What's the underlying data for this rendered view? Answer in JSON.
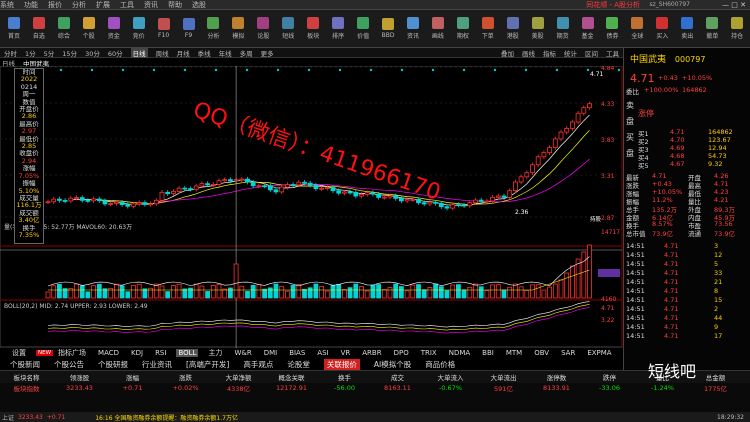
{
  "titlebar": {
    "menu": [
      "系统",
      "功能",
      "报价",
      "分析",
      "扩展",
      "工具",
      "资讯",
      "帮助",
      "选股"
    ],
    "brand": "同花顺 - A股分析",
    "right": "sz_SH600797"
  },
  "toolbar": {
    "buttons": [
      {
        "label": "首页",
        "color": "#4a7fd0"
      },
      {
        "label": "自选",
        "color": "#d04040"
      },
      {
        "label": "综合",
        "color": "#40a060"
      },
      {
        "label": "个股",
        "color": "#d0a030"
      },
      {
        "label": "资金",
        "color": "#a050c0"
      },
      {
        "label": "竞价",
        "color": "#40a0c0"
      },
      {
        "label": "F10",
        "color": "#c05050"
      },
      {
        "label": "F9",
        "color": "#5070c0"
      },
      {
        "label": "分析",
        "color": "#50a050"
      },
      {
        "label": "模拟",
        "color": "#c08030"
      },
      {
        "label": "论股",
        "color": "#a04080"
      },
      {
        "label": "短线",
        "color": "#4080a0"
      },
      {
        "label": "板块",
        "color": "#d04040"
      },
      {
        "label": "排序",
        "color": "#7070c0"
      },
      {
        "label": "价值",
        "color": "#40a060"
      },
      {
        "label": "BBD",
        "color": "#c0a030"
      },
      {
        "label": "资讯",
        "color": "#5090d0"
      },
      {
        "label": "画线",
        "color": "#c06060"
      },
      {
        "label": "期权",
        "color": "#50a080"
      },
      {
        "label": "下单",
        "color": "#d05030"
      },
      {
        "label": "港股",
        "color": "#6070b0"
      },
      {
        "label": "美股",
        "color": "#a0a040"
      },
      {
        "label": "期货",
        "color": "#4090b0"
      },
      {
        "label": "基金",
        "color": "#b05090"
      },
      {
        "label": "债券",
        "color": "#50b050"
      },
      {
        "label": "全球",
        "color": "#c07030"
      },
      {
        "label": "买入",
        "color": "#d03030"
      },
      {
        "label": "卖出",
        "color": "#3070d0"
      },
      {
        "label": "撤单",
        "color": "#60a060"
      },
      {
        "label": "持仓",
        "color": "#b0a030"
      }
    ]
  },
  "periodbar": {
    "items": [
      "分时",
      "1分",
      "5分",
      "15分",
      "30分",
      "60分",
      "日线",
      "周线",
      "月线",
      "季线",
      "年线",
      "多周",
      "更多"
    ],
    "active": 6,
    "right": [
      "叠加",
      "画线",
      "指标",
      "统计",
      "区间",
      "工具"
    ]
  },
  "chartinfo": {
    "label": "日线",
    "name": "中国武夷"
  },
  "datawin": {
    "rows": [
      "时间",
      "2022",
      "0214",
      "周一",
      "数值",
      "开盘价",
      "2.86",
      "最高价",
      "2.97",
      "最低价",
      "2.85",
      "收盘价",
      "2.94",
      "涨幅",
      "7.05%",
      "振幅",
      "5.10%",
      "成交量",
      "116.1万",
      "成交额",
      "3.40亿",
      "换手",
      "7.35%"
    ]
  },
  "volinfo": {
    "text": "量(手)  MAVOL5: 52.77万  MAVOL60: 20.63万"
  },
  "bollinfo": {
    "text": "BOLL(20,2) MID: 2.74  UPPER: 2.93  LOWER: 2.49"
  },
  "annotations": {
    "low": "2.36",
    "low2": "2.36",
    "high": "4.71",
    "date": "2022-02-14",
    "flag": "持股"
  },
  "yaxis_main": [
    "4.84",
    "4.33",
    "3.83",
    "3.31",
    "2.87"
  ],
  "yaxis_vol": [
    "14717",
    "8578",
    "4160"
  ],
  "yaxis_boll": [
    "4.71",
    "3.22"
  ],
  "watermark": "QQ（微信）：411966170",
  "indicator_tabs": {
    "new": "NEW",
    "items": [
      "指标广场",
      "MACD",
      "KDJ",
      "RSI",
      "BOLL",
      "主力",
      "W&R",
      "DMI",
      "BIAS",
      "ASI",
      "VR",
      "ARBR",
      "DPO",
      "TRIX",
      "NDMA",
      "BBI",
      "MTM",
      "OBV",
      "SAR",
      "EXPMA"
    ],
    "active": 4,
    "prefix": "设置"
  },
  "bottom_tabs": {
    "items": [
      "个股新闻",
      "个股公告",
      "个股研报",
      "行业资讯",
      "[高端产开发]",
      "高手观点",
      "论股堂",
      "关联报价",
      "AI模拟个股",
      "商品价格"
    ],
    "active": 7
  },
  "sectors": {
    "header": [
      "板块名称",
      "领涨股",
      "涨幅",
      "涨跌",
      "大单净额",
      "概念关联",
      "换手",
      "成交",
      "大单流入",
      "大单流出",
      "涨停数",
      "跌停",
      "量比",
      "总金额"
    ],
    "row1": [
      "板块指数",
      "3233.43",
      "+0.71",
      "+0.02%",
      "4338亿",
      "12172.91",
      "-56.00",
      "8163.11",
      "-0.67%",
      "591亿",
      "8133.91",
      "-33.06",
      "-1.24%",
      "1775亿"
    ]
  },
  "status": {
    "left": "上证",
    "ticker1": "3233.43",
    "ticker2": "+0.71",
    "msg": "16:16 全国融资融券余额提醒：融资融券余额1.7万亿",
    "time": "18:29:32"
  },
  "stock": {
    "name": "中国武夷",
    "code": "000797",
    "price": "4.71",
    "change": "+0.43",
    "pct": "+10.05%"
  },
  "orderbook": {
    "labels": [
      "委比",
      "委差"
    ],
    "weibi": "+100.00%",
    "weicha": "164862",
    "sell": [
      {
        "l": "卖5",
        "p": "",
        "v": ""
      },
      {
        "l": "卖4",
        "p": "",
        "v": ""
      },
      {
        "l": "卖3",
        "p": "",
        "v": ""
      },
      {
        "l": "卖2",
        "p": "",
        "v": ""
      },
      {
        "l": "卖1",
        "p": "",
        "v": ""
      }
    ],
    "buy": [
      {
        "l": "买1",
        "p": "4.71",
        "v": "164862"
      },
      {
        "l": "买2",
        "p": "4.70",
        "v": "123.67"
      },
      {
        "l": "买3",
        "p": "4.69",
        "v": "12.94"
      },
      {
        "l": "买4",
        "p": "4.68",
        "v": "54.73"
      },
      {
        "l": "买5",
        "p": "4.67",
        "v": "9.32"
      }
    ],
    "status": "涨停"
  },
  "quote": [
    [
      "最新",
      "4.71",
      "开盘",
      "4.26"
    ],
    [
      "涨跌",
      "+0.43",
      "最高",
      "4.71"
    ],
    [
      "涨幅",
      "+10.05%",
      "最低",
      "4.23"
    ],
    [
      "振幅",
      "11.2%",
      "量比",
      "4.21"
    ],
    [
      "总手",
      "135.2万",
      "外盘",
      "89.3万"
    ],
    [
      "金额",
      "6.14亿",
      "内盘",
      "45.9万"
    ],
    [
      "换手",
      "8.57%",
      "市盈",
      "73.56"
    ],
    [
      "总市值",
      "73.9亿",
      "流通",
      "73.9亿"
    ]
  ],
  "ticks": [
    [
      "14:51",
      "4.71",
      "3"
    ],
    [
      "14:51",
      "4.71",
      "12"
    ],
    [
      "14:51",
      "4.71",
      "5"
    ],
    [
      "14:51",
      "4.71",
      "33"
    ],
    [
      "14:51",
      "4.71",
      "21"
    ],
    [
      "14:51",
      "4.71",
      "8"
    ],
    [
      "14:51",
      "4.71",
      "15"
    ],
    [
      "14:51",
      "4.71",
      "2"
    ],
    [
      "14:51",
      "4.71",
      "44"
    ],
    [
      "14:51",
      "4.71",
      "9"
    ],
    [
      "14:51",
      "4.71",
      "17"
    ]
  ],
  "logo": "短线吧",
  "colors": {
    "up": "#ff3030",
    "down": "#00d4d4",
    "ma5": "#ffffff",
    "ma10": "#ffff00",
    "ma20": "#ff00ff"
  }
}
